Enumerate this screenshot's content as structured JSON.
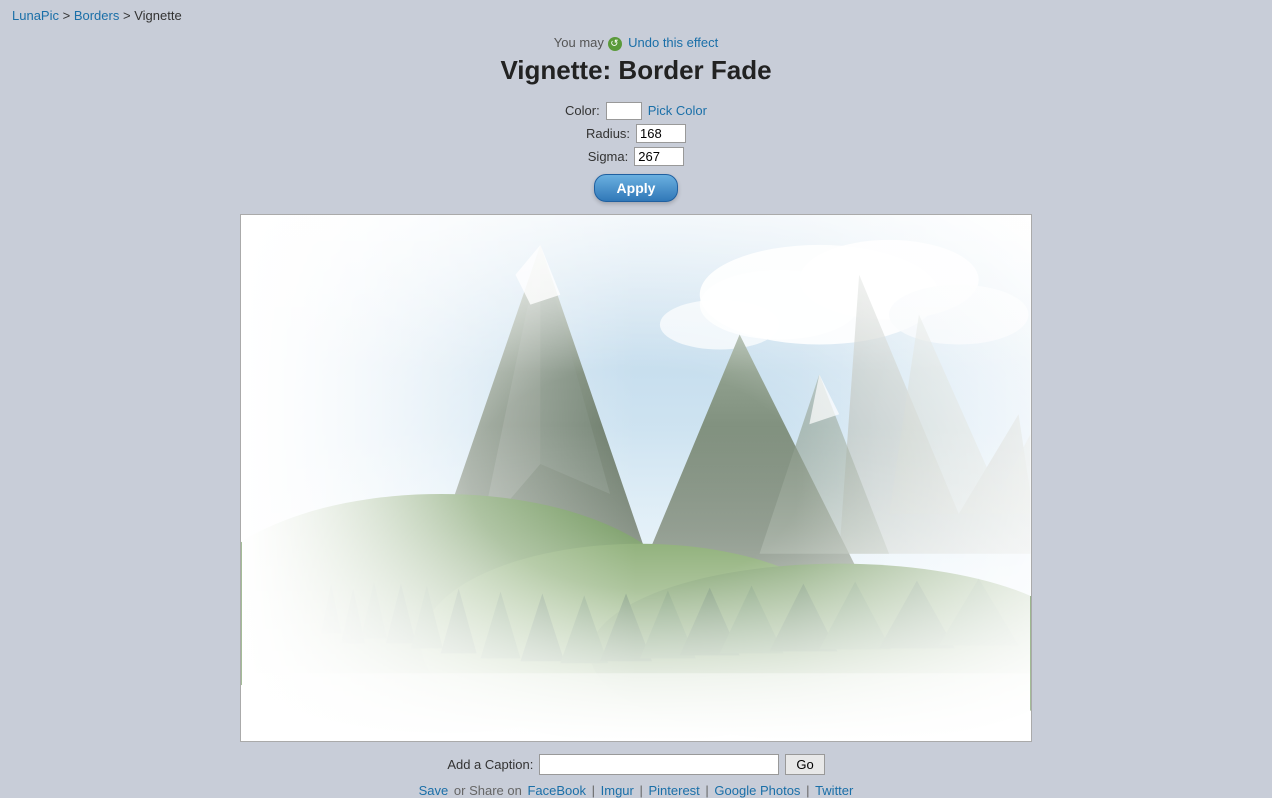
{
  "breadcrumb": {
    "lunapic_label": "LunaPic",
    "lunapic_href": "#",
    "borders_label": "Borders",
    "borders_href": "#",
    "current_label": "Vignette",
    "separator": " > "
  },
  "header": {
    "undo_prefix": "You may",
    "undo_link_label": "Undo this effect",
    "title": "Vignette: Border Fade"
  },
  "controls": {
    "color_label": "Color:",
    "pick_color_label": "Pick Color",
    "radius_label": "Radius:",
    "radius_value": "168",
    "sigma_label": "Sigma:",
    "sigma_value": "267",
    "apply_label": "Apply"
  },
  "caption": {
    "label": "Add a Caption:",
    "placeholder": "",
    "go_label": "Go"
  },
  "share": {
    "save_label": "Save",
    "share_prefix": "or Share on",
    "facebook_label": "FaceBook",
    "imgur_label": "Imgur",
    "pinterest_label": "Pinterest",
    "google_photos_label": "Google Photos",
    "twitter_label": "Twitter"
  }
}
